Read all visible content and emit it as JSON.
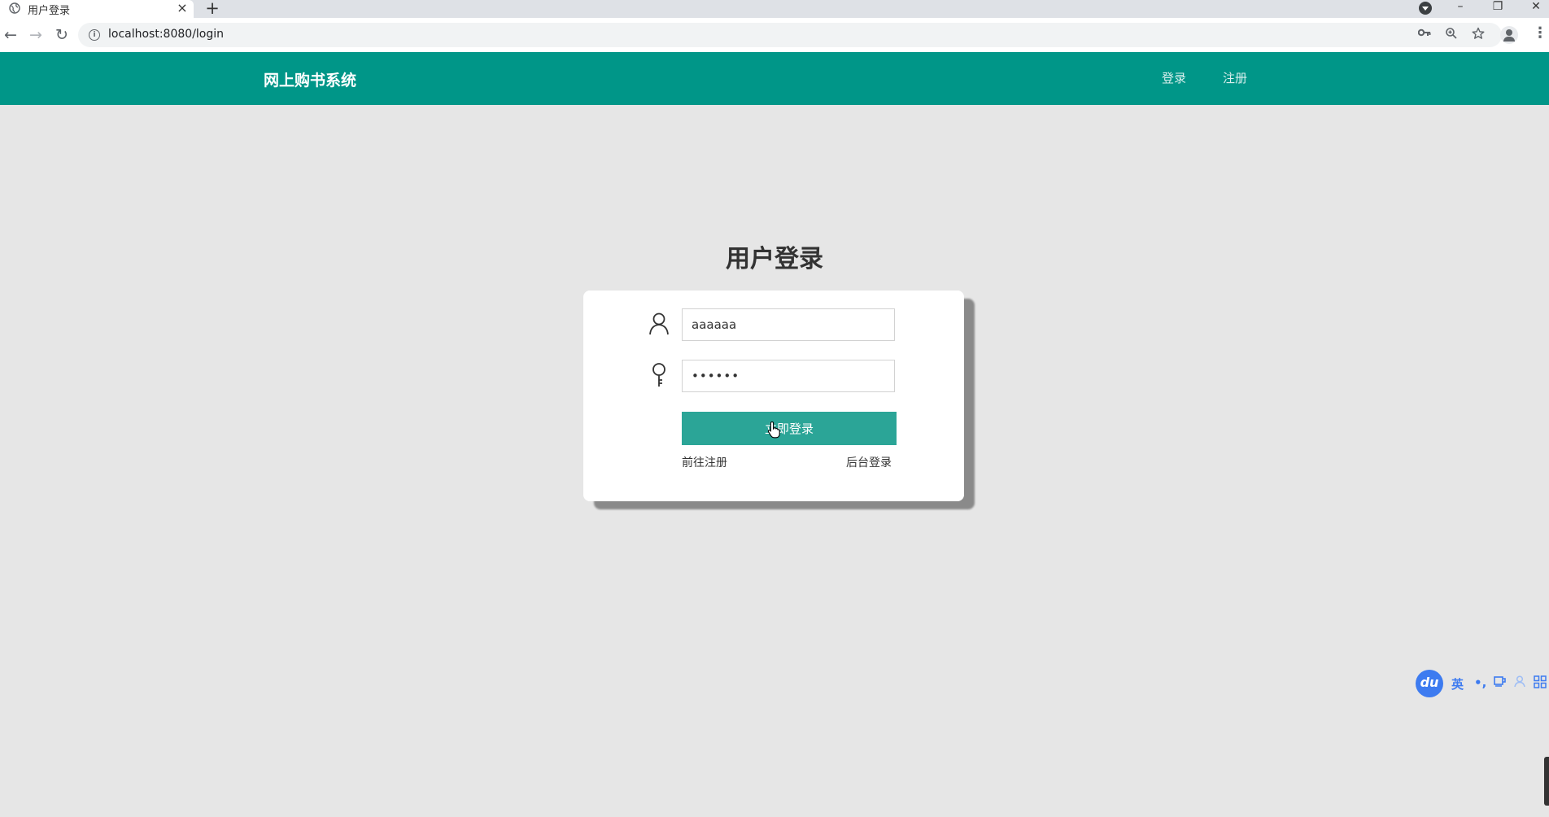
{
  "browser": {
    "tab_title": "用户登录",
    "new_tab_label": "+",
    "url": "localhost:8080/login",
    "window_controls": {
      "minimize": "–",
      "restore": "❐",
      "close": "✕"
    },
    "icons": [
      "back-arrow-icon",
      "forward-arrow-icon",
      "reload-icon",
      "info-icon",
      "key-icon",
      "zoom-icon",
      "star-icon",
      "account-icon",
      "more-icon"
    ]
  },
  "header": {
    "brand": "网上购书系统",
    "nav": [
      {
        "label": "登录"
      },
      {
        "label": "注册"
      }
    ],
    "color": "#009688"
  },
  "login": {
    "title": "用户登录",
    "username_value": "aaaaaa",
    "password_value": "••••••",
    "submit_label": "立即登录",
    "register_link": "前往注册",
    "admin_link": "后台登录",
    "button_color": "#2ba597"
  },
  "ime": {
    "logo": "du",
    "items": [
      "英",
      "•,",
      "☕",
      "👤",
      "▦"
    ]
  }
}
